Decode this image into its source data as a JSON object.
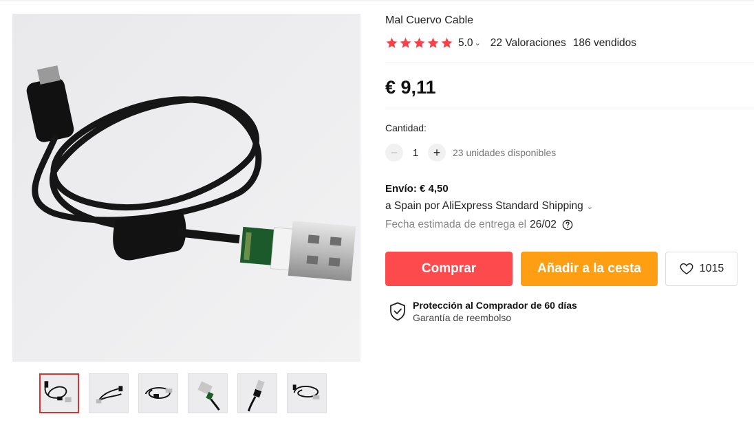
{
  "product": {
    "title": "Mal Cuervo Cable",
    "rating": "5.0",
    "reviews": "22 Valoraciones",
    "sold": "186 vendidos",
    "price": "€ 9,11"
  },
  "quantity": {
    "label": "Cantidad:",
    "value": "1",
    "available": "23 unidades disponibles"
  },
  "shipping": {
    "cost": "Envío: € 4,50",
    "via": "a Spain por AliExpress Standard Shipping",
    "delivery_label": "Fecha estimada de entrega el",
    "delivery_date": "26/02"
  },
  "actions": {
    "buy": "Comprar",
    "add_to_cart": "Añadir a la cesta",
    "wishlist_count": "1015"
  },
  "protection": {
    "title": "Protección al Comprador de 60 días",
    "subtitle": "Garantía de reembolso"
  },
  "colors": {
    "star": "#f5424a",
    "buy": "#fd4a4d",
    "cart": "#fe9f13",
    "active_thumb_border": "#e0302d"
  },
  "icons": {
    "star": "star-icon",
    "chevron": "chevron-down-icon",
    "minus": "minus-icon",
    "plus": "plus-icon",
    "help": "question-circle-icon",
    "wishlist": "heart-icon",
    "protection": "shield-check-icon"
  }
}
